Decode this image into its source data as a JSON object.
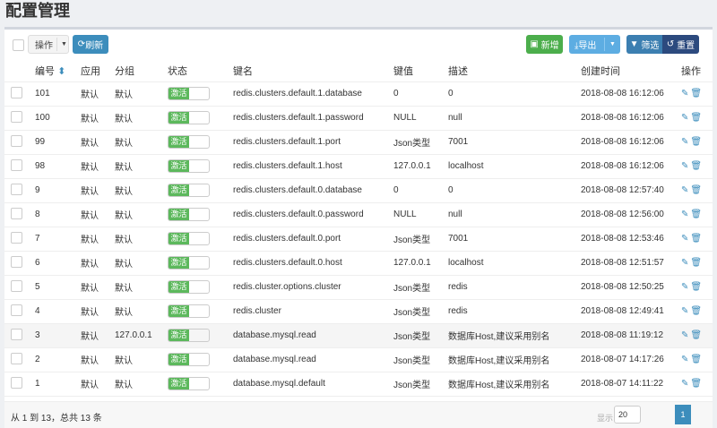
{
  "title": "配置管理",
  "toolbar": {
    "ops": "操作",
    "refresh": "刷新",
    "add": "新增",
    "export": "导出",
    "filter": "筛选",
    "reset": "重置"
  },
  "columns": [
    "编号",
    "应用",
    "分组",
    "状态",
    "键名",
    "键值",
    "描述",
    "创建时间",
    "操作"
  ],
  "rows": [
    [
      "101",
      "默认",
      "默认",
      "激活",
      "redis.clusters.default.1.database",
      "0",
      "0",
      "2018-08-08 16:12:06"
    ],
    [
      "100",
      "默认",
      "默认",
      "激活",
      "redis.clusters.default.1.password",
      "NULL",
      "null",
      "2018-08-08 16:12:06"
    ],
    [
      "99",
      "默认",
      "默认",
      "激活",
      "redis.clusters.default.1.port",
      "Json类型",
      "7001",
      "2018-08-08 16:12:06"
    ],
    [
      "98",
      "默认",
      "默认",
      "激活",
      "redis.clusters.default.1.host",
      "127.0.0.1",
      "localhost",
      "2018-08-08 16:12:06"
    ],
    [
      "9",
      "默认",
      "默认",
      "激活",
      "redis.clusters.default.0.database",
      "0",
      "0",
      "2018-08-08 12:57:40"
    ],
    [
      "8",
      "默认",
      "默认",
      "激活",
      "redis.clusters.default.0.password",
      "NULL",
      "null",
      "2018-08-08 12:56:00"
    ],
    [
      "7",
      "默认",
      "默认",
      "激活",
      "redis.clusters.default.0.port",
      "Json类型",
      "7001",
      "2018-08-08 12:53:46"
    ],
    [
      "6",
      "默认",
      "默认",
      "激活",
      "redis.clusters.default.0.host",
      "127.0.0.1",
      "localhost",
      "2018-08-08 12:51:57"
    ],
    [
      "5",
      "默认",
      "默认",
      "激活",
      "redis.cluster.options.cluster",
      "Json类型",
      "redis",
      "2018-08-08 12:50:25"
    ],
    [
      "4",
      "默认",
      "默认",
      "激活",
      "redis.cluster",
      "Json类型",
      "redis",
      "2018-08-08 12:49:41"
    ],
    [
      "3",
      "默认",
      "127.0.0.1",
      "激活",
      "database.mysql.read",
      "Json类型",
      "数据库Host,建议采用别名",
      "2018-08-08 11:19:12"
    ],
    [
      "2",
      "默认",
      "默认",
      "激活",
      "database.mysql.read",
      "Json类型",
      "数据库Host,建议采用别名",
      "2018-08-07 14:17:26"
    ],
    [
      "1",
      "默认",
      "默认",
      "激活",
      "database.mysql.default",
      "Json类型",
      "数据库Host,建议采用别名",
      "2018-08-07 14:11:22"
    ]
  ],
  "footer": {
    "summary": "从 1 到 13，总共 13 条",
    "show": "显示",
    "page_size": "20",
    "page": "1"
  },
  "colors": {
    "green": "#4cae4c",
    "blue": "#3c8dbc",
    "lightblue": "#5dade2",
    "navy": "#2c4a7e"
  }
}
